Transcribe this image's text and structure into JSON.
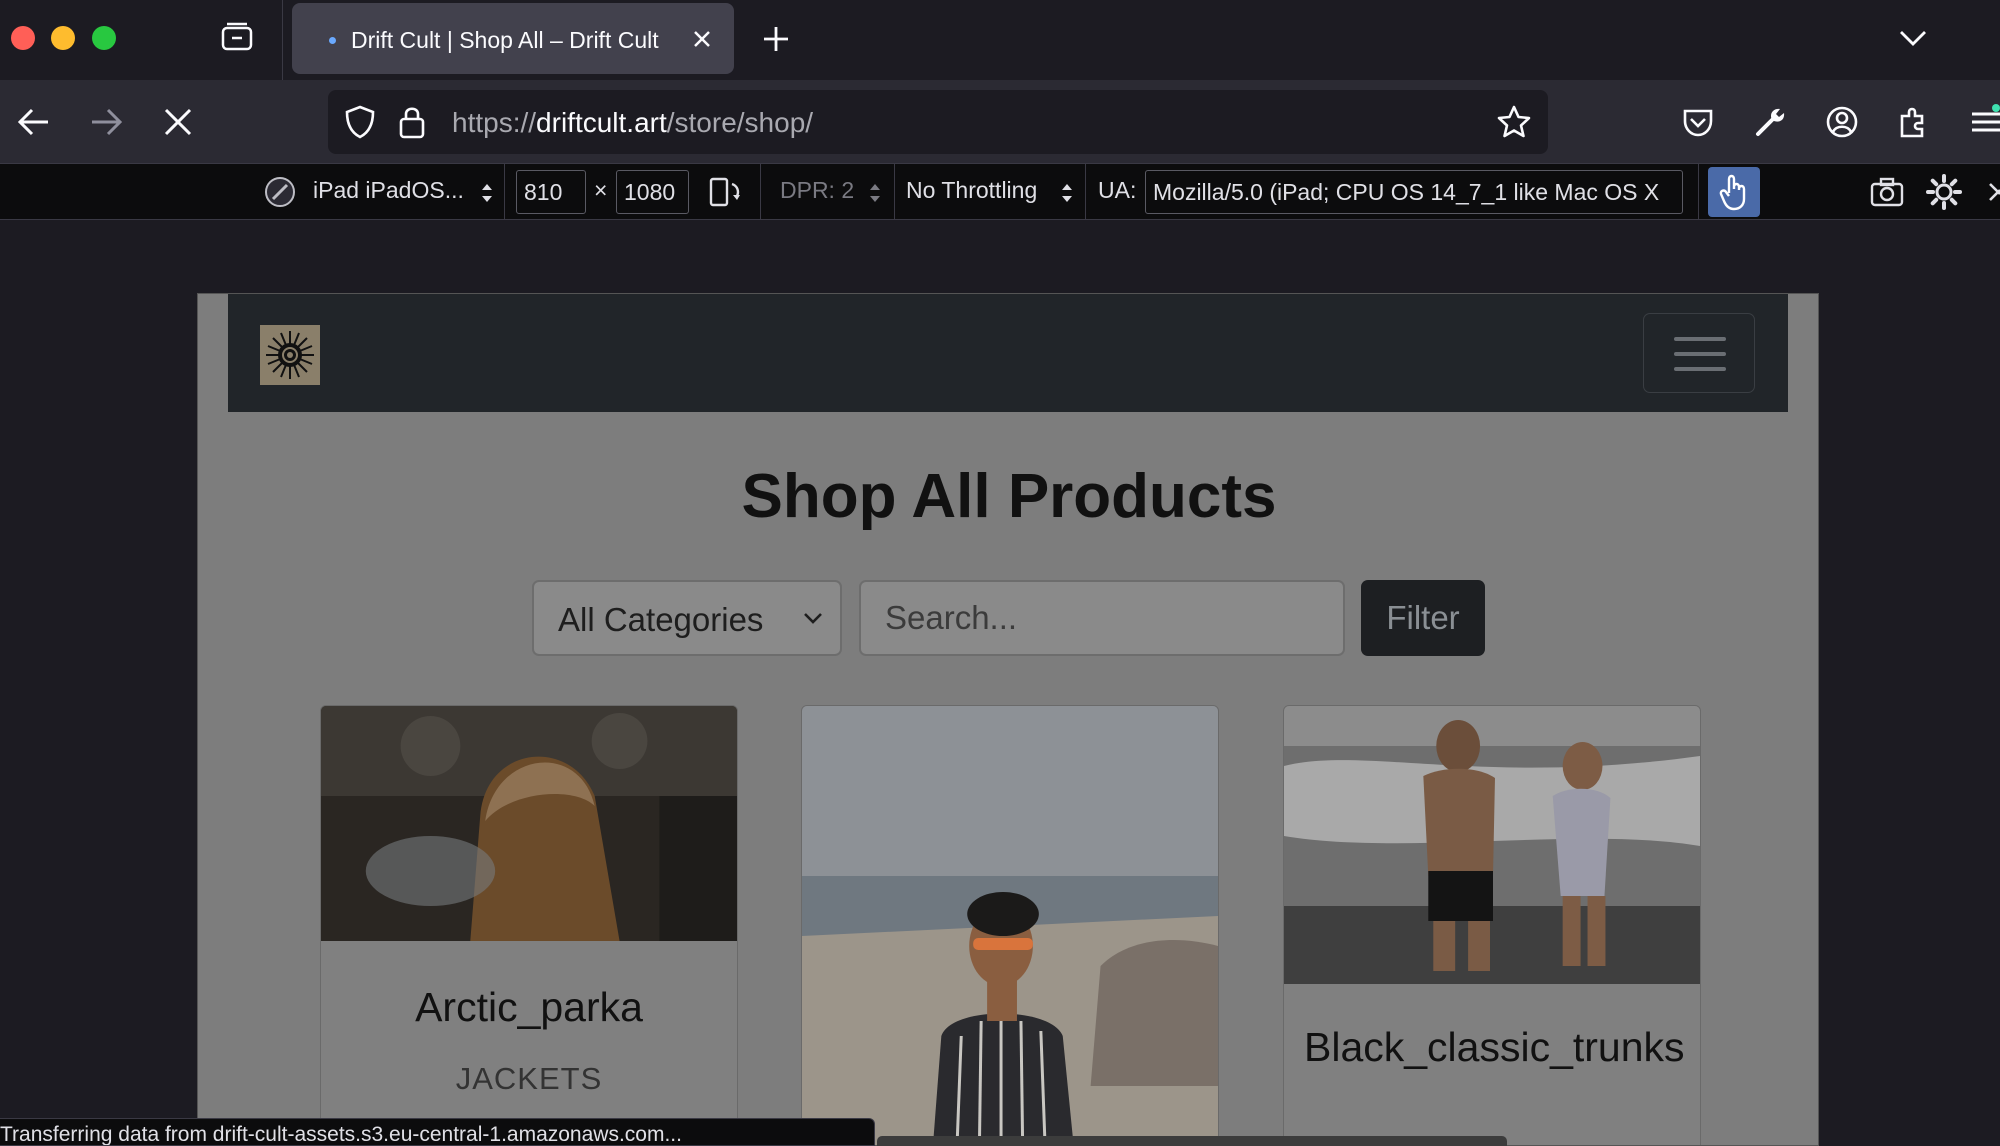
{
  "browser": {
    "tab": {
      "title": "Drift Cult | Shop All – Drift Cult"
    },
    "url": {
      "prefix": "https://",
      "domain": "driftcult.art",
      "path": "/store/shop/"
    }
  },
  "rdm": {
    "device": "iPad iPadOS...",
    "width": "810",
    "times": "×",
    "height": "1080",
    "dpr": "DPR: 2",
    "throttling": "No Throttling",
    "ua_label": "UA:",
    "ua_value": "Mozilla/5.0 (iPad; CPU OS 14_7_1 like Mac OS X"
  },
  "page": {
    "title": "Shop All Products",
    "filters": {
      "category_selected": "All Categories",
      "search_placeholder": "Search...",
      "filter_label": "Filter"
    },
    "products": [
      {
        "name": "Arctic_parka",
        "category": "JACKETS"
      },
      {
        "name": "",
        "category": ""
      },
      {
        "name": "Black_classic_trunks",
        "category": ""
      }
    ]
  },
  "status": {
    "text": "Transferring data from drift-cult-assets.s3.eu-central-1.amazonaws.com..."
  },
  "colors": {
    "accent": "#4a6aa8",
    "site_nav": "#212529",
    "page_overlay": "#7d7d7d"
  }
}
